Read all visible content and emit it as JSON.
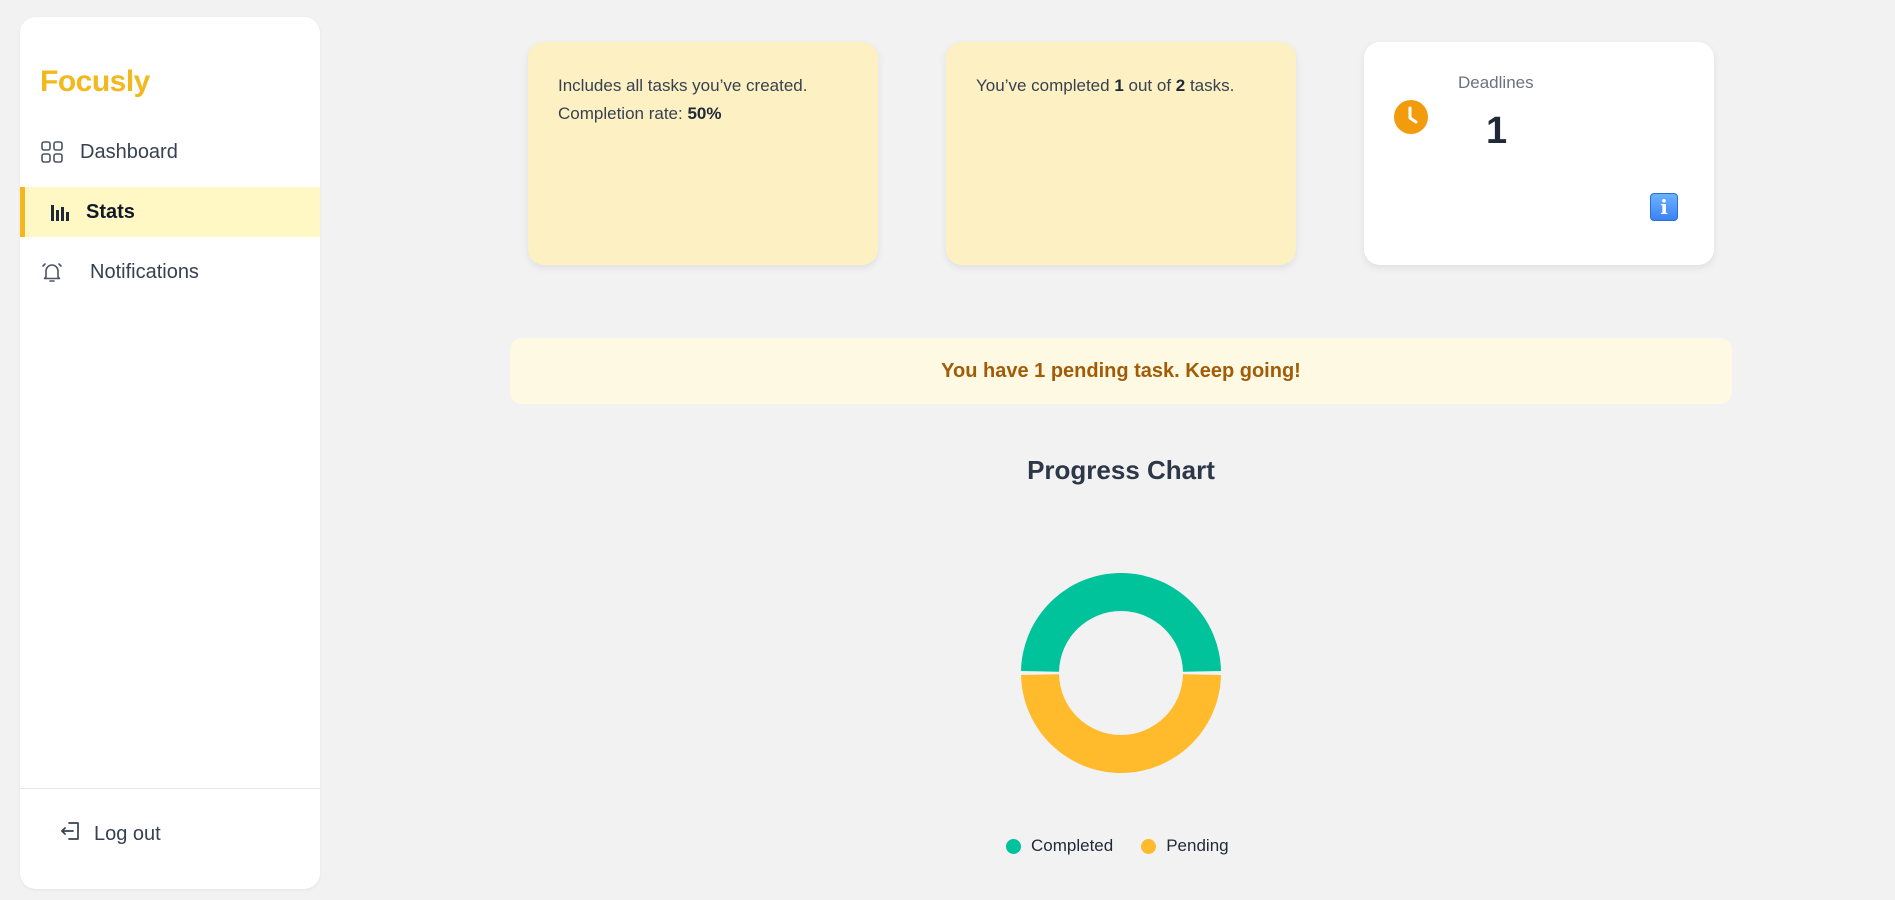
{
  "app": {
    "name": "Focusly",
    "brand_color": "#f2b81d"
  },
  "sidebar": {
    "items": [
      {
        "label": "Dashboard",
        "icon": "grid-icon",
        "active": false
      },
      {
        "label": "Stats",
        "icon": "bar-chart-icon",
        "active": true
      },
      {
        "label": "Notifications",
        "icon": "bell-icon",
        "active": false
      }
    ],
    "logout": {
      "label": "Log out",
      "icon": "logout-icon"
    }
  },
  "cards": {
    "total": {
      "line1": "Includes all tasks you’ve created.",
      "line2_prefix": "Completion rate: ",
      "line2_value": "50%"
    },
    "completed": {
      "text_a": "You’ve completed ",
      "completed_count": "1",
      "text_b": " out of ",
      "total_count": "2",
      "text_c": " tasks."
    },
    "deadlines": {
      "label": "Deadlines",
      "value": "1",
      "icon": "clock-icon",
      "info_icon": "info-icon",
      "info_glyph": "i"
    }
  },
  "banner": {
    "text": "You have 1 pending task. Keep going!"
  },
  "chart_data": {
    "type": "pie",
    "title": "Progress Chart",
    "categories": [
      "Completed",
      "Pending"
    ],
    "values": [
      1,
      1
    ],
    "colors": [
      "#00c29b",
      "#ffbb2c"
    ],
    "donut": true,
    "legend_position": "bottom"
  }
}
